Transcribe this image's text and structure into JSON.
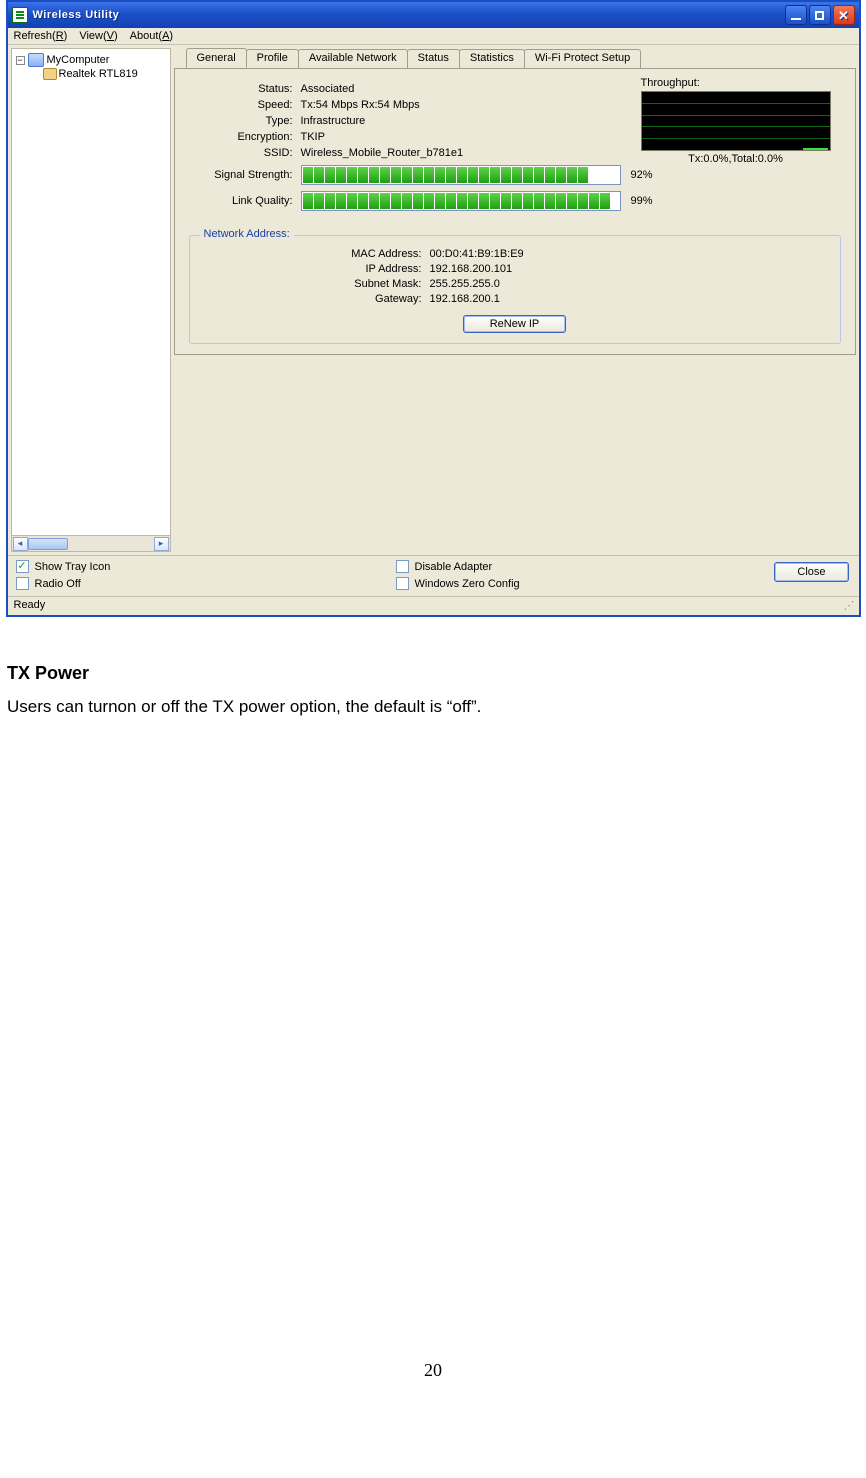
{
  "window": {
    "title": "Wireless Utility"
  },
  "menu": {
    "refresh": "Refresh(R)",
    "view": "View(V)",
    "about": "About(A)"
  },
  "tree": {
    "root": "MyComputer",
    "adapter": "Realtek RTL819"
  },
  "tabs": [
    "General",
    "Profile",
    "Available Network",
    "Status",
    "Statistics",
    "Wi-Fi Protect Setup"
  ],
  "general": {
    "labels": {
      "status": "Status:",
      "speed": "Speed:",
      "type": "Type:",
      "encryption": "Encryption:",
      "ssid": "SSID:",
      "signal": "Signal Strength:",
      "link": "Link Quality:"
    },
    "values": {
      "status": "Associated",
      "speed": "Tx:54 Mbps Rx:54 Mbps",
      "type": "Infrastructure",
      "encryption": "TKIP",
      "ssid": "Wireless_Mobile_Router_b781e1",
      "signal_pct": "92%",
      "link_pct": "99%"
    },
    "throughput": {
      "label": "Throughput:",
      "caption": "Tx:0.0%,Total:0.0%"
    }
  },
  "network": {
    "title": "Network Address:",
    "labels": {
      "mac": "MAC Address:",
      "ip": "IP Address:",
      "subnet": "Subnet Mask:",
      "gateway": "Gateway:"
    },
    "values": {
      "mac": "00:D0:41:B9:1B:E9",
      "ip": "192.168.200.101",
      "subnet": "255.255.255.0",
      "gateway": "192.168.200.1"
    },
    "renew_btn": "ReNew IP"
  },
  "checks": {
    "show_tray": "Show Tray Icon",
    "radio_off": "Radio Off",
    "disable_adapter": "Disable Adapter",
    "zero_config": "Windows Zero Config"
  },
  "close_btn": "Close",
  "status_text": "Ready",
  "doc": {
    "heading": "TX Power",
    "para": "Users can turnon or off the TX power option, the default is “off”.",
    "page": "20"
  }
}
